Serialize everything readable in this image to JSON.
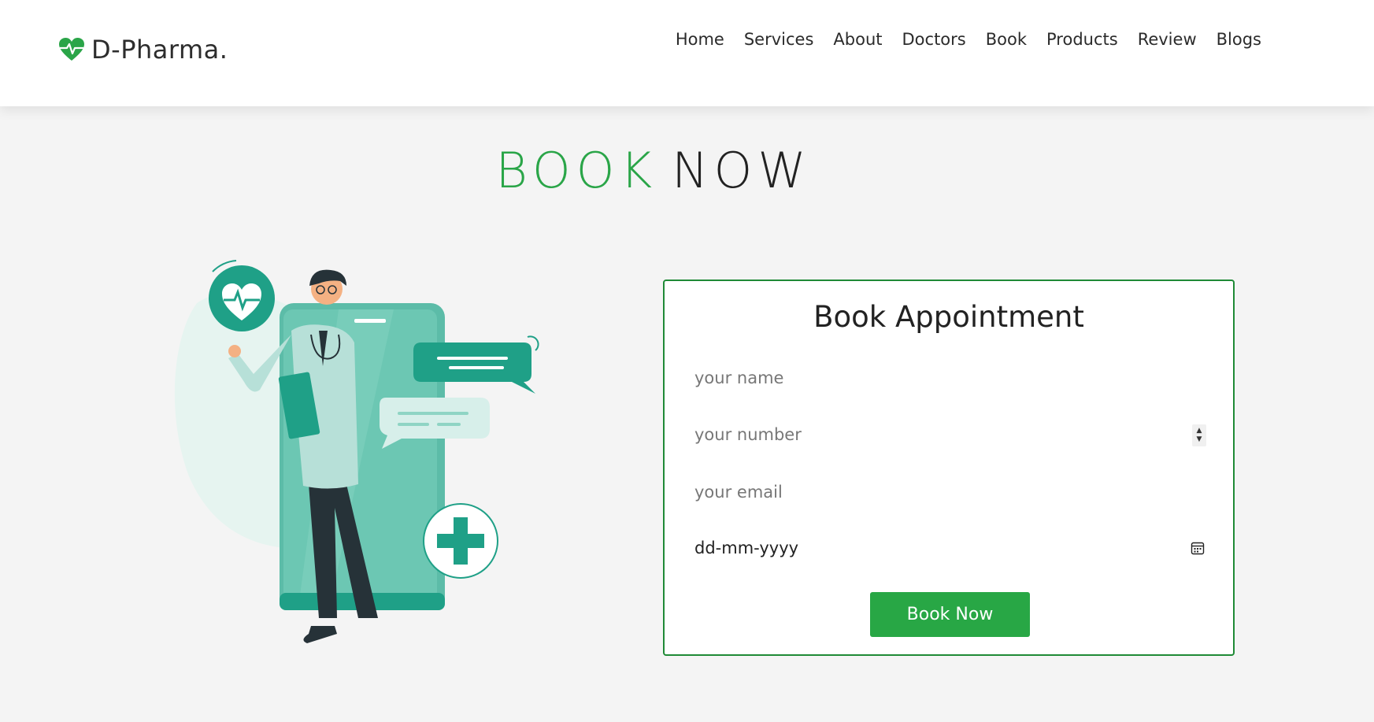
{
  "brand": {
    "name": "D-Pharma.",
    "icon": "heart-pulse-icon"
  },
  "nav": {
    "items": [
      "Home",
      "Services",
      "About",
      "Doctors",
      "Book",
      "Products",
      "Review",
      "Blogs"
    ]
  },
  "heading": {
    "green_part": "BOOK",
    "dark_part": "NOW"
  },
  "form": {
    "title": "Book Appointment",
    "name_placeholder": "your name",
    "number_placeholder": "your number",
    "email_placeholder": "your email",
    "date_value": "dd-mm-yyyy",
    "submit_label": "Book Now"
  },
  "colors": {
    "accent_green": "#2aa548",
    "button_green": "#28a745",
    "border_green": "#1f8a36",
    "illustration_teal": "#1fa087"
  }
}
